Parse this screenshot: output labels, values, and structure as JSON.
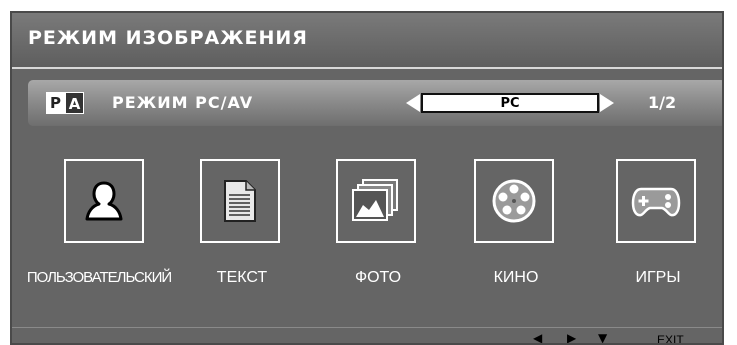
{
  "title": "РЕЖИМ ИЗОБРАЖЕНИЯ",
  "mode_row": {
    "icon_letters": [
      "P",
      "A"
    ],
    "label": "РЕЖИМ PC/AV",
    "value": "PC",
    "page_indicator": "1/2"
  },
  "modes": [
    {
      "name": "ПОЛЬЗОВАТЕЛЬСКИЙ",
      "icon": "user-icon"
    },
    {
      "name": "ТЕКСТ",
      "icon": "document-icon"
    },
    {
      "name": "ФОТО",
      "icon": "photo-icon"
    },
    {
      "name": "КИНО",
      "icon": "film-reel-icon"
    },
    {
      "name": "ИГРЫ",
      "icon": "gamepad-icon"
    }
  ],
  "footer": {
    "left_glyph": "◀",
    "right_glyph": "▶",
    "down_glyph": "▼",
    "exit_label": "EXIT"
  },
  "colors": {
    "panel": "#656565",
    "highlight": "#ffffff",
    "text": "#ffffff"
  }
}
